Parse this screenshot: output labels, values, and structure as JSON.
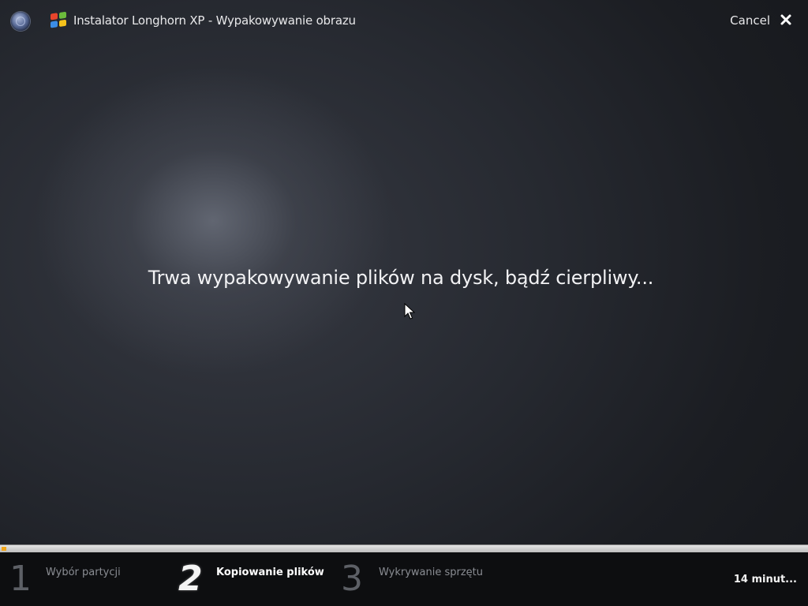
{
  "window": {
    "title": "Instalator Longhorn XP - Wypakowywanie obrazu",
    "cancel_label": "Cancel"
  },
  "icons": {
    "menu": "globe-orb-icon",
    "app": "windows-logo-icon",
    "close": "close-x-icon",
    "pointer": "mouse-cursor-icon"
  },
  "main": {
    "message": "Trwa wypakowywanie plików na dysk, bądź cierpliwy..."
  },
  "progress": {
    "value_percent": 0.6,
    "fill_color": "#f0a51a"
  },
  "steps": [
    {
      "number": "1",
      "label": "Wybór partycji",
      "state": "done"
    },
    {
      "number": "2",
      "label": "Kopiowanie plików",
      "state": "active"
    },
    {
      "number": "3",
      "label": "Wykrywanie sprzętu",
      "state": "pending"
    }
  ],
  "status": {
    "time_remaining": "14 minut..."
  },
  "colors": {
    "accent": "#f0a51a",
    "text": "#f2f2f4",
    "inactive_step": "#8a8d93"
  }
}
